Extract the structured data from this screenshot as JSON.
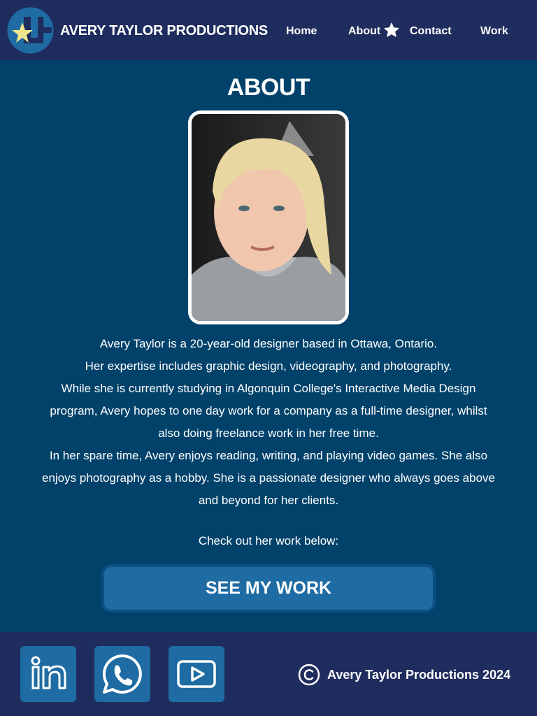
{
  "header": {
    "brand": "AVERY TAYLOR PRODUCTIONS",
    "nav": [
      {
        "label": "Home"
      },
      {
        "label": "About"
      },
      {
        "label": "Contact"
      },
      {
        "label": "Work"
      }
    ],
    "active_indicator_icon": "star-icon"
  },
  "main": {
    "title": "ABOUT",
    "bio": [
      "Avery Taylor is a 20-year-old designer based in Ottawa, Ontario.",
      "Her expertise includes graphic design, videography, and photography.",
      "While she is currently studying in Algonquin College's Interactive Media Design program, Avery hopes to one day work for a company as a full-time designer, whilst also doing freelance work in her free time.",
      "In her spare time, Avery enjoys reading, writing, and playing video games. She also enjoys photography as a hobby. She is a passionate designer who always goes above and beyond for her clients."
    ],
    "cta_text": "Check out her work below:",
    "cta_button": "SEE MY WORK"
  },
  "footer": {
    "social": [
      {
        "icon": "linkedin-icon"
      },
      {
        "icon": "whatsapp-icon"
      },
      {
        "icon": "youtube-icon"
      }
    ],
    "copyright": "Avery Taylor Productions 2024"
  },
  "colors": {
    "background": "#01426b",
    "header_footer": "#1f2c5e",
    "accent_button": "#1e6ca3",
    "logo_yellow": "#f1e88e"
  }
}
